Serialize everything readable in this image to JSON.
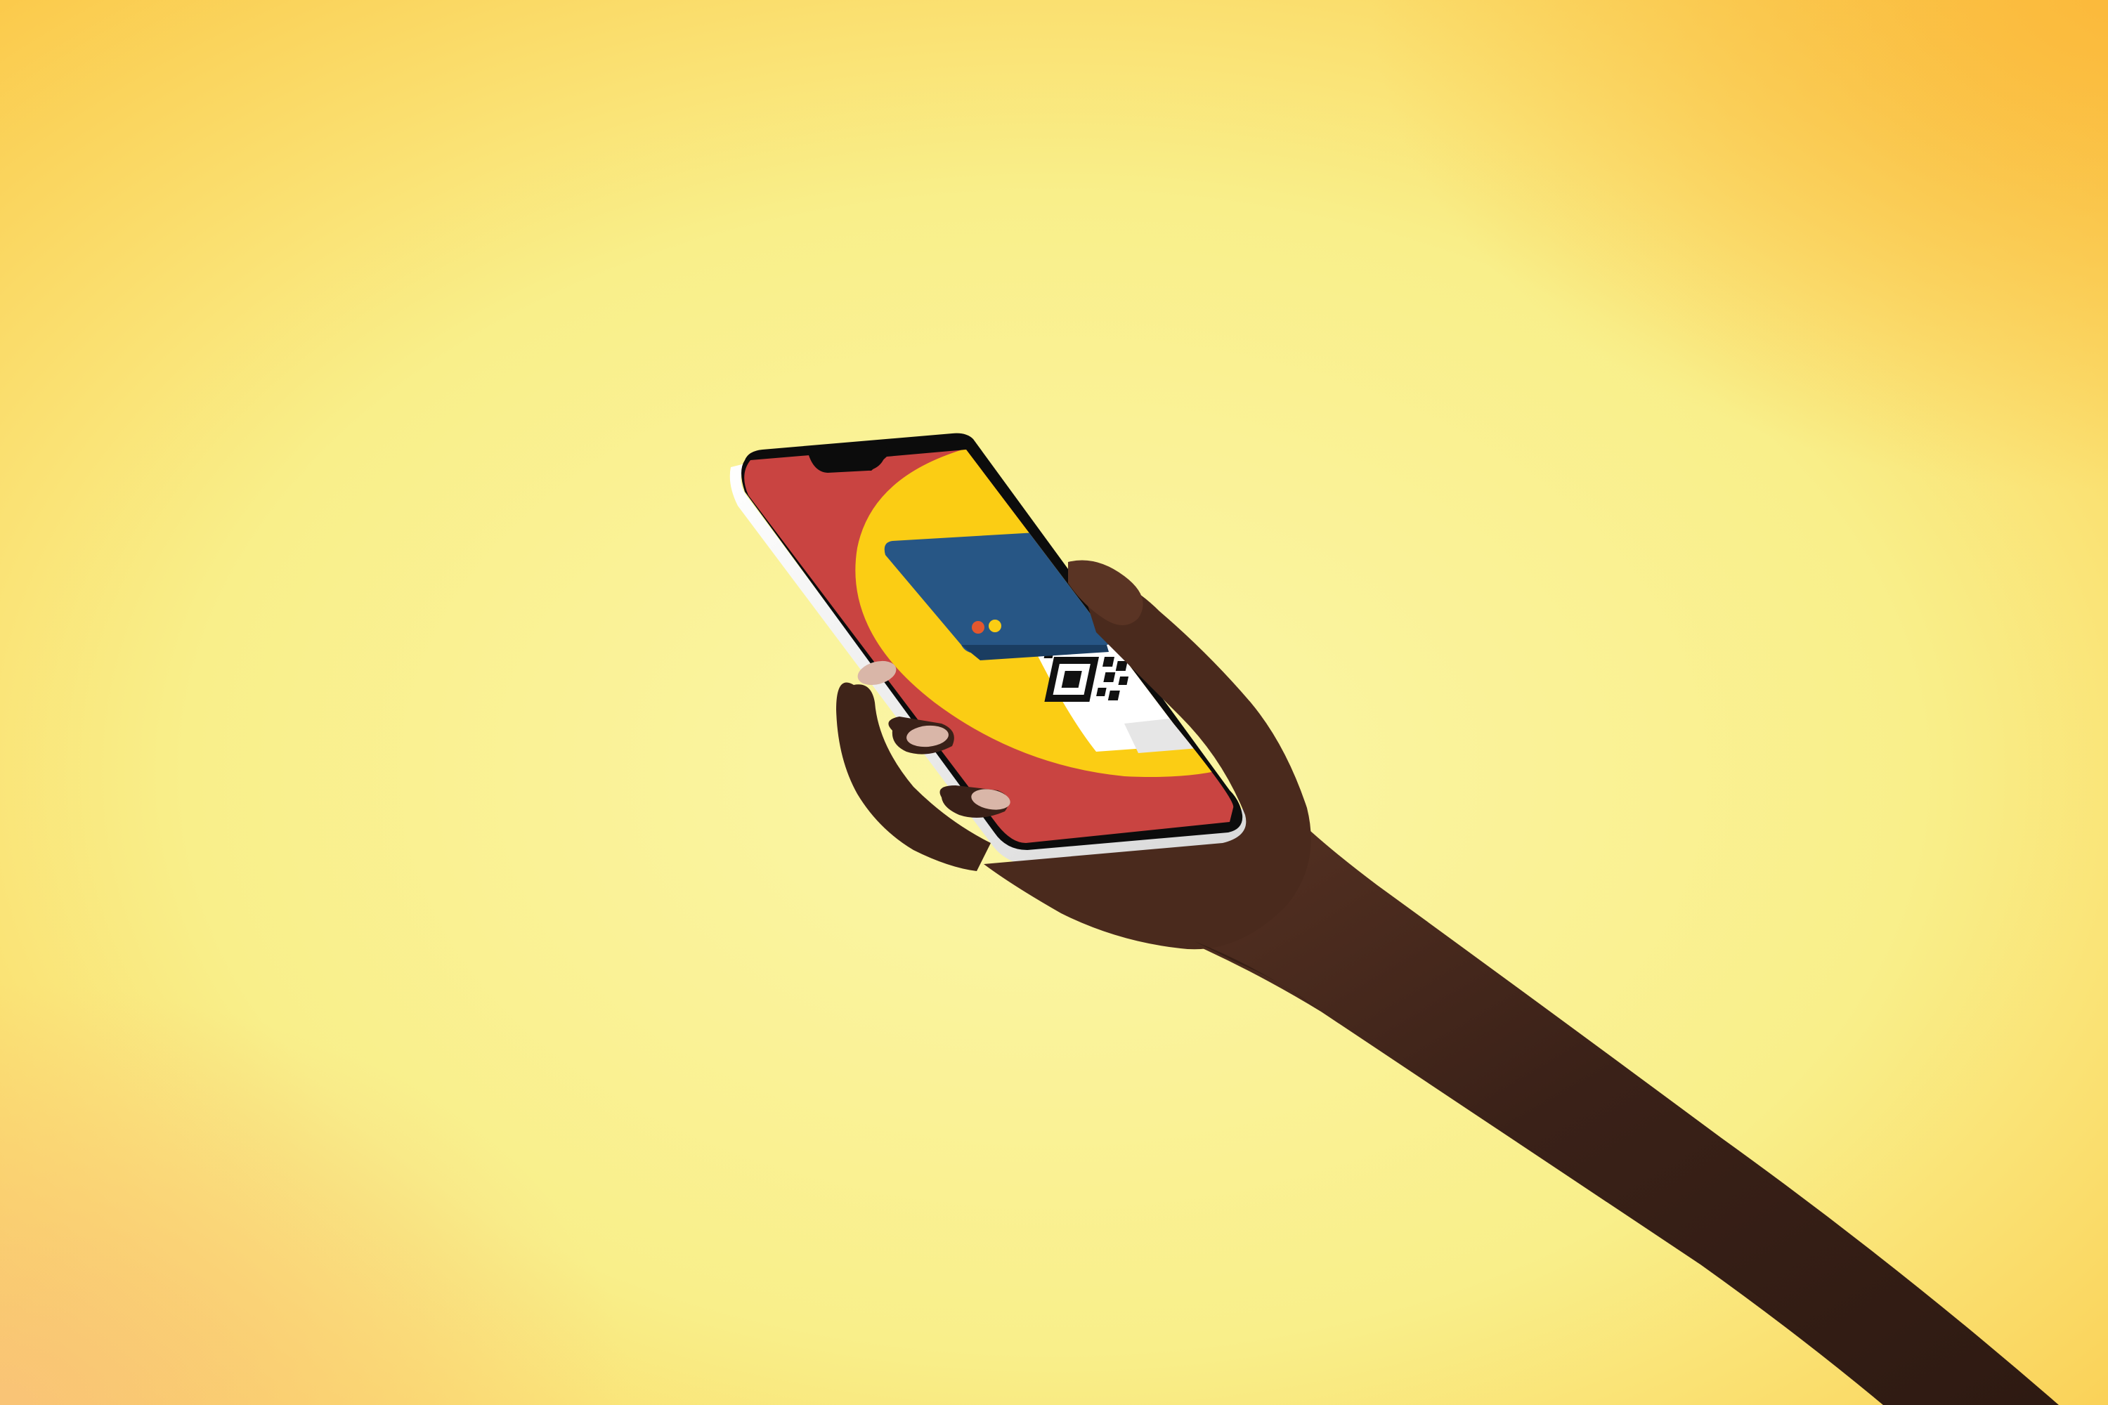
{
  "scene": {
    "description_free": true,
    "colors": {
      "background_center": "#fbf6a8",
      "background_mid": "#f9ef8a",
      "background_edge": "#fbc94a",
      "background_corner_warm": "#f9c27a",
      "screen_red": "#c94441",
      "screen_yellow": "#fbcd14",
      "card_blue": "#275685",
      "dot_orange": "#e4572e",
      "dot_yellow": "#fbcd14",
      "qr_black": "#111111",
      "qr_white": "#ffffff",
      "phone_frame": "#f2f2f2",
      "phone_bezel": "#0c0c0c",
      "skin_dark": "#3a2118",
      "skin_mid": "#5a3424",
      "skin_light": "#7a4a34",
      "nail": "#d9b6a8"
    },
    "icons": {
      "card_dots": "dot-indicator-icon",
      "qr": "qr-code-icon",
      "usb_port": "usb-port-icon",
      "speaker": "speaker-grille-icon"
    }
  }
}
